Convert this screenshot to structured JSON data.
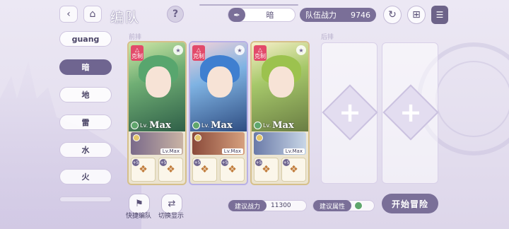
{
  "header": {
    "title": "编队",
    "element": "暗",
    "power_label": "队伍战力",
    "power_value": "9746"
  },
  "element_list": [
    "guang",
    "暗",
    "地",
    "雷",
    "水",
    "火"
  ],
  "active_element": "暗",
  "sections": {
    "front": "前排",
    "back": "后排"
  },
  "cards": [
    {
      "tag": "克制",
      "level_prefix": "Lv.",
      "level": "Max",
      "memory_level": "Lv.Max",
      "chip_plus": [
        "+5",
        "+5"
      ]
    },
    {
      "tag": "克制",
      "level_prefix": "Lv.",
      "level": "Max",
      "memory_level": "Lv.Max",
      "chip_plus": [
        "+5",
        "+5"
      ]
    },
    {
      "tag": "克制",
      "level_prefix": "Lv.",
      "level": "Max",
      "memory_level": "Lv.Max",
      "chip_plus": [
        "+5",
        "+5"
      ]
    }
  ],
  "bottom": {
    "quick_team": "快捷编队",
    "switch_display": "切换显示",
    "recommended_power_label": "建议战力",
    "recommended_power_value": "11300",
    "recommended_attr_label": "建议属性",
    "start_button": "开始冒险"
  },
  "colors": {
    "accent": "#7a6f98",
    "counter": "#e24a6a",
    "attr": "#5fa66c"
  }
}
